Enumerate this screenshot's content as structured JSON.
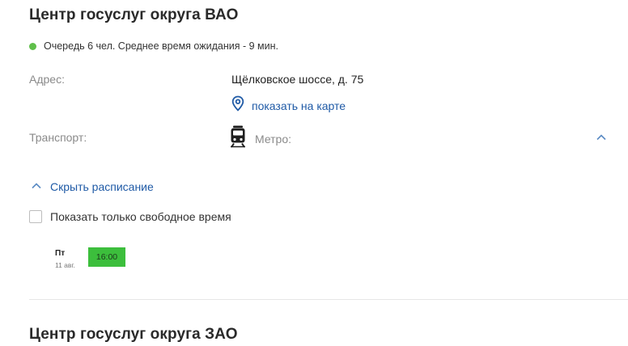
{
  "offices": [
    {
      "title": "Центр госуслуг округа ВАО",
      "queue_text": "Очередь 6 чел. Среднее время ожидания - 9 мин.",
      "address_label": "Адрес:",
      "address_value": "Щёлковское шоссе, д. 75",
      "map_link": "показать на карте",
      "transport_label": "Транспорт:",
      "metro_label": "Метро:",
      "schedule_toggle": "Скрыть расписание",
      "free_time_label": "Показать только свободное время",
      "free_time_checked": false,
      "schedule": [
        {
          "day": "Пт",
          "date": "11 авг.",
          "slots": [
            "16:00"
          ]
        }
      ]
    },
    {
      "title": "Центр госуслуг округа ЗАО"
    }
  ],
  "colors": {
    "accent_link": "#1f5aa6",
    "queue_dot": "#5fbf4a",
    "slot_free": "#3cbe3c"
  },
  "icons": {
    "queue": "status-dot",
    "map": "map-pin-icon",
    "metro": "train-icon",
    "collapse": "chevron-up-icon"
  }
}
